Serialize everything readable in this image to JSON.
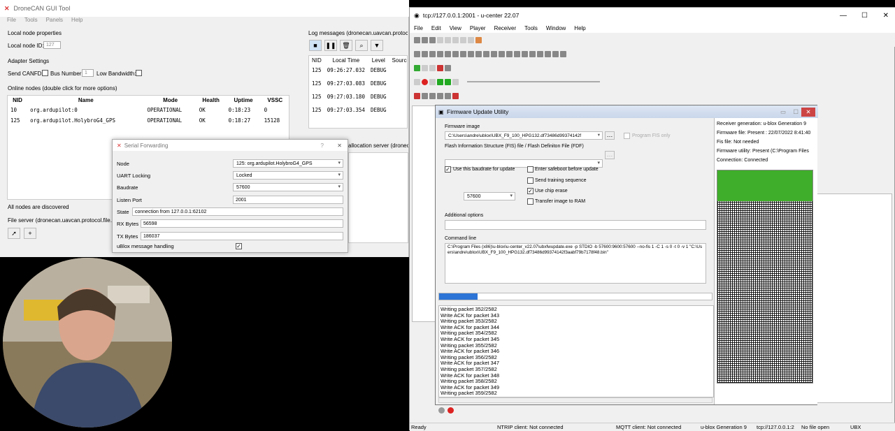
{
  "dronecan": {
    "title": "DroneCAN GUI Tool",
    "menu": [
      "File",
      "Tools",
      "Panels",
      "Help"
    ],
    "local_node_props": "Local node properties",
    "local_node_id_label": "Local node ID:",
    "local_node_id_value": "127",
    "adapter_settings": "Adapter Settings",
    "send_canfd": "Send CANFD:",
    "bus_number": "Bus Number:",
    "bus_number_value": "1",
    "low_bandwidth": "Low Bandwidth:",
    "online_nodes": "Online nodes (double click for more options)",
    "nodes_headers": [
      "NID",
      "Name",
      "Mode",
      "Health",
      "Uptime",
      "VSSC"
    ],
    "nodes": [
      {
        "nid": "10",
        "name": "org.ardupilot:0",
        "mode": "OPERATIONAL",
        "health": "OK",
        "uptime": "0:18:23",
        "vssc": "0"
      },
      {
        "nid": "125",
        "name": "org.ardupilot.HolybroG4_GPS",
        "mode": "OPERATIONAL",
        "health": "OK",
        "uptime": "0:18:27",
        "vssc": "15128"
      }
    ],
    "all_discovered": "All nodes are discovered",
    "file_server": "File server (dronecan.uavcan.protocol.file.*)",
    "log_messages": "Log messages (dronecan.uavcan.protocol.debug.LogMessage)",
    "log_headers": [
      "NID",
      "Local Time",
      "Level",
      "Source"
    ],
    "logs": [
      {
        "nid": "125",
        "time": "09:26:27.032",
        "level": "DEBUG"
      },
      {
        "nid": "125",
        "time": "09:27:03.083",
        "level": "DEBUG"
      },
      {
        "nid": "125",
        "time": "09:27:03.180",
        "level": "DEBUG"
      },
      {
        "nid": "125",
        "time": "09:27:03.354",
        "level": "DEBUG"
      }
    ],
    "allocation_server": "allocation server (dronecan"
  },
  "serial_forwarding": {
    "title": "Serial Forwarding",
    "node_label": "Node",
    "node_value": "125: org.ardupilot.HolybroG4_GPS",
    "uart_label": "UART Locking",
    "uart_value": "Locked",
    "baud_label": "Baudrate",
    "baud_value": "57600",
    "port_label": "Listen Port",
    "port_value": "2001",
    "state_label": "State",
    "state_value": "connection from 127.0.0.1:62102",
    "rx_label": "RX Bytes",
    "rx_value": "56598",
    "tx_label": "TX Bytes",
    "tx_value": "186037",
    "ublox_label": "uBlox message handling"
  },
  "ucenter": {
    "title": "tcp://127.0.0.1:2001 - u-center 22.07",
    "menu": [
      "File",
      "Edit",
      "View",
      "Player",
      "Receiver",
      "Tools",
      "Window",
      "Help"
    ],
    "right_panel": {
      "receiver_gen": "Receiver generation: u-blox Generation 9",
      "fw_file": "Firmware file: Present : 22/07/2022 8:41:40",
      "fis_file": "Fis file: Not needed",
      "fw_utility": "Firmware utility: Present (C:\\Program Files",
      "connection": "Connection: Connected"
    },
    "status": {
      "ready": "Ready",
      "ntrip": "NTRIP client: Not connected",
      "mqtt": "MQTT client: Not connected",
      "gen": "u-blox Generation 9",
      "tcp": "tcp://127.0.0.1:2",
      "nofile": "No file open",
      "ubx": "UBX"
    }
  },
  "firmware_update": {
    "title": "Firmware Update Utility",
    "fw_image_label": "Firmware image",
    "fw_image_value": "C:\\Users\\andre\\ublox\\UBX_F9_100_HPG132.df73486d99374142f",
    "program_fis_only": "Program FIS only",
    "fis_label": "Flash Information Structure (FIS) file / Flash Definiton File (FDF)",
    "use_baud": "Use this baudrate for update",
    "baud_value": "57600",
    "safeboot": "Enter safeboot before update",
    "training": "Send training sequence",
    "chip_erase": "Use chip erase",
    "transfer_ram": "Transfer image to RAM",
    "additional_options": "Additional options",
    "command_line_label": "Command line",
    "command_line": "C:\\Program Files (x86)\\u-blox\\u-center_v22.07\\ubxfwupdate.exe -p STDIO -b 57600:9600:57600 --no-fis 1 -C 1 -s 0 -t 0 -v 1 \"C:\\Users\\andre\\ublox\\UBX_F9_100_HPG132.df73486d99374142f3aabf79b7178f48.bin\"",
    "progress": 0.14,
    "log": [
      "Writing packet 352/2582",
      "Write ACK for packet 343",
      "Writing packet 353/2582",
      "Write ACK for packet 344",
      "Writing packet 354/2582",
      "Write ACK for packet 345",
      "Writing packet 355/2582",
      "Write ACK for packet 346",
      "Writing packet 356/2582",
      "Write ACK for packet 347",
      "Writing packet 357/2582",
      "Write ACK for packet 348",
      "Writing packet 358/2582",
      "Write ACK for packet 349",
      "Writing packet 359/2582"
    ]
  }
}
